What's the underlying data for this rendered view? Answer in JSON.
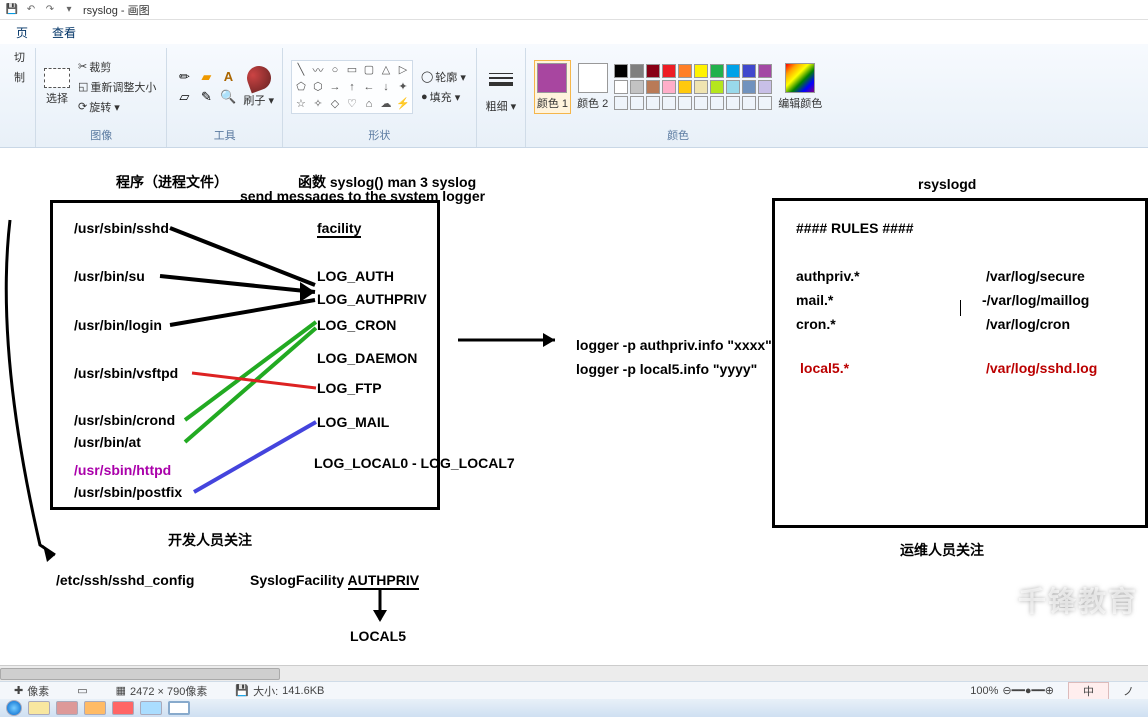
{
  "titlebar": {
    "title": "rsyslog - 画图",
    "arrow": "▾"
  },
  "tabs": {
    "home": "页",
    "view": "查看"
  },
  "ribbon": {
    "clipboard": {
      "cut": "切",
      "label_paste": "制"
    },
    "image": {
      "select": "选择",
      "crop": "裁剪",
      "resize": "重新调整大小",
      "rotate": "旋转 ▾",
      "group": "图像"
    },
    "tools": {
      "brush": "刷子 ▾",
      "group": "工具"
    },
    "shapes": {
      "outline": "轮廓 ▾",
      "fill": "填充 ▾",
      "group": "形状"
    },
    "thickness": {
      "label": "粗细 ▾"
    },
    "colors": {
      "c1": "颜色 1",
      "c2": "颜色 2",
      "edit": "编辑颜色",
      "group": "颜色"
    }
  },
  "diagram": {
    "title_left": "程序（进程文件）",
    "title_mid1": "函数 syslog()  man 3 syslog",
    "title_mid2": "send messages to the system logger",
    "title_right": "rsyslogd",
    "facility": "facility",
    "progs": [
      "/usr/sbin/sshd",
      "/usr/bin/su",
      "/usr/bin/login",
      "/usr/sbin/vsftpd",
      "/usr/sbin/crond",
      "/usr/bin/at",
      "/usr/sbin/httpd",
      "/usr/sbin/postfix"
    ],
    "facilities": [
      "LOG_AUTH",
      "LOG_AUTHPRIV",
      "LOG_CRON",
      "LOG_DAEMON",
      "LOG_FTP",
      "LOG_MAIL",
      "LOG_LOCAL0 - LOG_LOCAL7"
    ],
    "logger1": "logger  -p authpriv.info \"xxxx\"",
    "logger2": "logger -p local5.info \"yyyy\"",
    "dev_note": "开发人员关注",
    "ops_note": "运维人员关注",
    "sshd_config": "/etc/ssh/sshd_config",
    "syslog_fac": "SyslogFacility ",
    "authpriv": "AUTHPRIV",
    "local5": "LOCAL5",
    "rules": {
      "header": "#### RULES ####",
      "r1k": "authpriv.*",
      "r1v": "/var/log/secure",
      "r2k": "mail.*",
      "r2v": "-/var/log/maillog",
      "r3k": "cron.*",
      "r3v": "/var/log/cron",
      "r4k": "local5.*",
      "r4v": "/var/log/sshd.log"
    }
  },
  "status": {
    "px_label": "像素",
    "dims": "2472 × 790像素",
    "size_label": "大小:",
    "size": "141.6KB",
    "zoom": "100%",
    "ime1": "中",
    "ime2": "ノ"
  },
  "watermark": "千锋教育"
}
